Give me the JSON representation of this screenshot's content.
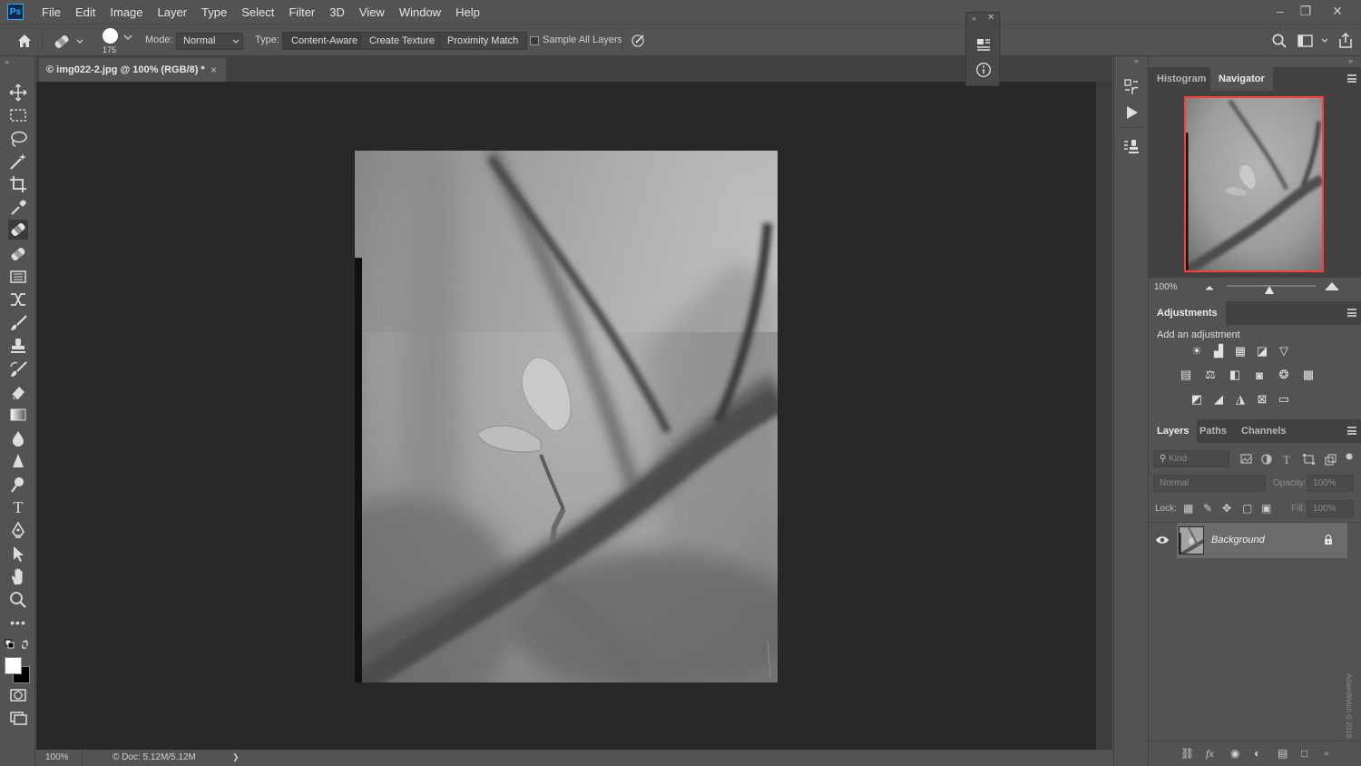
{
  "app": {
    "logo": "Ps",
    "name": "Adobe Photoshop"
  },
  "menubar": {
    "items": [
      "File",
      "Edit",
      "Image",
      "Layer",
      "Type",
      "Select",
      "Filter",
      "3D",
      "View",
      "Window",
      "Help"
    ]
  },
  "window_controls": {
    "minimize": "–",
    "restore": "❐",
    "close": "✕"
  },
  "options_bar": {
    "brush_size": "175",
    "mode_label": "Mode:",
    "mode_value": "Normal",
    "type_label": "Type:",
    "type_buttons": [
      "Content-Aware",
      "Create Texture",
      "Proximity Match"
    ],
    "sample_all_layers": "Sample All Layers",
    "sample_all_layers_checked": false
  },
  "document": {
    "tab_title": "© img022-2.jpg @ 100% (RGB/8) *",
    "tab_close": "×",
    "zoom": "100%",
    "doc_size": "© Doc: 5.12M/5.12M",
    "status_arrow": "❯"
  },
  "tools": [
    "move-tool",
    "marquee-tool",
    "lasso-tool",
    "magic-wand-tool",
    "crop-tool",
    "eyedropper-tool",
    "spot-healing-tool",
    "healing-brush-tool",
    "patch-tool",
    "content-aware-move-tool",
    "brush-tool",
    "clone-stamp-tool",
    "history-brush-tool",
    "eraser-tool",
    "gradient-tool",
    "blur-tool",
    "sharpen-tool",
    "dodge-tool",
    "type-tool",
    "pen-tool",
    "path-selection-tool",
    "hand-tool",
    "zoom-tool",
    "more-tools"
  ],
  "colors": {
    "foreground": "#ffffff",
    "background": "#000000",
    "accent": "#31a8ff",
    "navigator_frame": "#ff3b3b"
  },
  "navigator_panel": {
    "tabs": [
      "Histogram",
      "Navigator"
    ],
    "active_tab": "Navigator",
    "zoom": "100%",
    "zoom_slider_fraction": 0.48
  },
  "adjustments_panel": {
    "title": "Adjustments",
    "subtitle": "Add an adjustment",
    "rows": [
      [
        "brightness-contrast-icon",
        "levels-icon",
        "curves-icon",
        "exposure-icon",
        "vibrance-icon"
      ],
      [
        "hue-saturation-icon",
        "color-balance-icon",
        "black-white-icon",
        "photo-filter-icon",
        "channel-mixer-icon",
        "color-lookup-icon"
      ],
      [
        "invert-icon",
        "posterize-icon",
        "threshold-icon",
        "selective-color-icon",
        "gradient-map-icon"
      ]
    ]
  },
  "layers_panel": {
    "tabs": [
      "Layers",
      "Paths",
      "Channels"
    ],
    "active_tab": "Layers",
    "filter_placeholder": "Kind",
    "blend_mode": "Normal",
    "opacity_label": "Opacity:",
    "opacity_value": "100%",
    "lock_label": "Lock:",
    "fill_label": "Fill:",
    "fill_value": "100%",
    "layers": [
      {
        "name": "Background",
        "visible": true,
        "locked": true
      }
    ]
  },
  "watermark": "AdamWelch © 2019"
}
